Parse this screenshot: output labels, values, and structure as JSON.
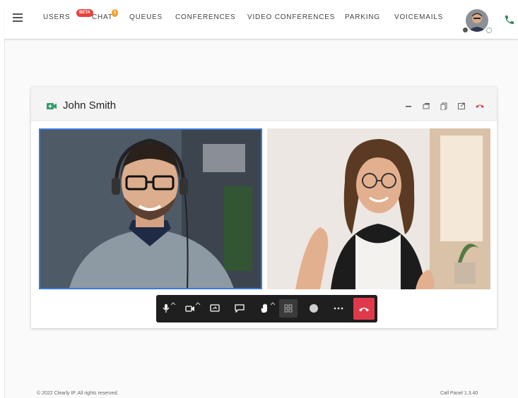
{
  "nav": {
    "menu_icon": "hamburger-icon",
    "items": [
      {
        "label": "USERS"
      },
      {
        "label": "CHAT",
        "badge": "BETA",
        "count": "1"
      },
      {
        "label": "QUEUES"
      },
      {
        "label": "CONFERENCES"
      },
      {
        "label": "VIDEO CONFERENCES"
      },
      {
        "label": "PARKING"
      },
      {
        "label": "VOICEMAILS"
      }
    ],
    "badge_color": "#e8403a",
    "count_color": "#f2a531",
    "phone_icon": "phone-icon",
    "phone_color": "#2e8b57"
  },
  "call": {
    "title": "John Smith",
    "title_icon": "video-camera-icon",
    "title_icon_color": "#2e9c6a",
    "header_actions": [
      "minimize-icon",
      "restore-icon",
      "copy-icon",
      "popout-icon",
      "hangup-icon"
    ],
    "participants": [
      {
        "id": "speaker",
        "description": "man with headset",
        "active_border": "#3a7bd5"
      },
      {
        "id": "remote",
        "description": "woman with glasses"
      }
    ]
  },
  "toolbar": {
    "buttons": [
      "microphone-icon",
      "camera-icon",
      "screen-share-icon",
      "chat-icon",
      "raise-hand-icon",
      "grid-view-icon",
      "record-icon",
      "more-icon"
    ],
    "hangup_color": "#e0394b",
    "active_button": "grid-view-icon"
  },
  "footer": {
    "copyright": "© 2022 Clearly IP. All rights reserved.",
    "version": "Call Panel 1.3.40"
  }
}
